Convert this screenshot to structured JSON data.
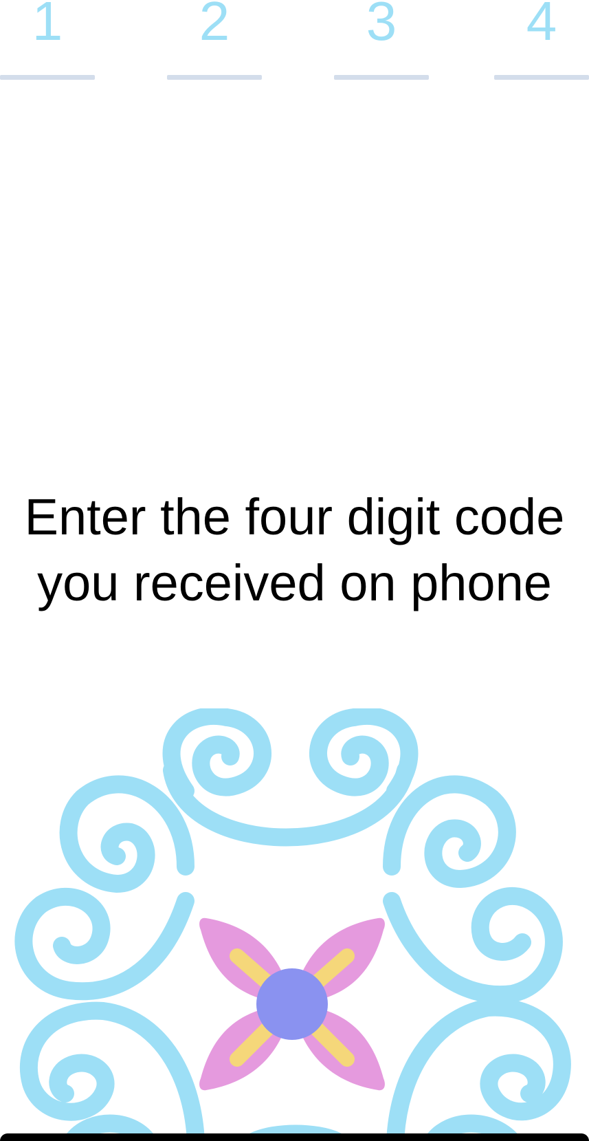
{
  "code_input": {
    "digits": [
      "1",
      "2",
      "3",
      "4"
    ],
    "digit_color": "#9ddff6",
    "underline_color": "#d3ddeb"
  },
  "prompt": {
    "line1": "Enter the four digit code",
    "line2": "you received on phone"
  },
  "ornament": {
    "swirl_color": "#9ddff6",
    "petal_color": "#e59ade",
    "stamen_color": "#f5d77a",
    "center_color": "#8a92f0"
  }
}
